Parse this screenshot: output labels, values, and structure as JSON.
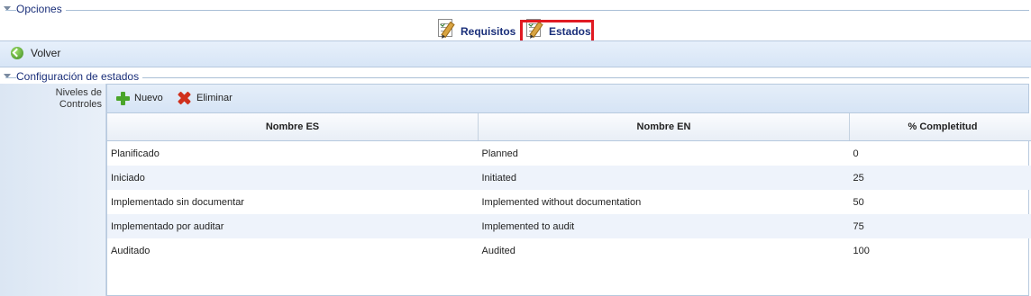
{
  "opciones": {
    "title": "Opciones"
  },
  "tabs": [
    {
      "label": "Requisitos",
      "icon": "edit-document-icon"
    },
    {
      "label": "Estados",
      "icon": "edit-document-icon",
      "selected": true
    }
  ],
  "toolbar": {
    "volver_label": "Volver",
    "volver_icon": "back-arrow-icon"
  },
  "config": {
    "title": "Configuración de estados"
  },
  "left_label": "Niveles de Controles",
  "grid": {
    "buttons": {
      "nuevo": "Nuevo",
      "eliminar": "Eliminar"
    },
    "columns": [
      "Nombre ES",
      "Nombre EN",
      "% Completitud"
    ],
    "rows": [
      [
        "Planificado",
        "Planned",
        "0"
      ],
      [
        "Iniciado",
        "Initiated",
        "25"
      ],
      [
        "Implementado sin documentar",
        "Implemented without documentation",
        "50"
      ],
      [
        "Implementado por auditar",
        "Implemented to audit",
        "75"
      ],
      [
        "Auditado",
        "Audited",
        "100"
      ]
    ]
  },
  "colors": {
    "highlight": "#e01a22",
    "title_text": "#1a2f7a",
    "toolbar_bg": "#dbe6f3",
    "alt_row": "#eef3fb"
  }
}
